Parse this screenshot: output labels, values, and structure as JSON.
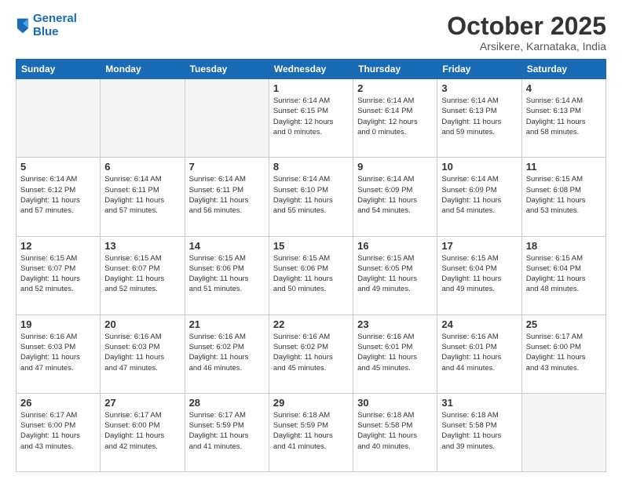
{
  "header": {
    "logo_line1": "General",
    "logo_line2": "Blue",
    "month_title": "October 2025",
    "location": "Arsikere, Karnataka, India"
  },
  "weekdays": [
    "Sunday",
    "Monday",
    "Tuesday",
    "Wednesday",
    "Thursday",
    "Friday",
    "Saturday"
  ],
  "weeks": [
    [
      {
        "day": "",
        "info": ""
      },
      {
        "day": "",
        "info": ""
      },
      {
        "day": "",
        "info": ""
      },
      {
        "day": "1",
        "info": "Sunrise: 6:14 AM\nSunset: 6:15 PM\nDaylight: 12 hours\nand 0 minutes."
      },
      {
        "day": "2",
        "info": "Sunrise: 6:14 AM\nSunset: 6:14 PM\nDaylight: 12 hours\nand 0 minutes."
      },
      {
        "day": "3",
        "info": "Sunrise: 6:14 AM\nSunset: 6:13 PM\nDaylight: 11 hours\nand 59 minutes."
      },
      {
        "day": "4",
        "info": "Sunrise: 6:14 AM\nSunset: 6:13 PM\nDaylight: 11 hours\nand 58 minutes."
      }
    ],
    [
      {
        "day": "5",
        "info": "Sunrise: 6:14 AM\nSunset: 6:12 PM\nDaylight: 11 hours\nand 57 minutes."
      },
      {
        "day": "6",
        "info": "Sunrise: 6:14 AM\nSunset: 6:11 PM\nDaylight: 11 hours\nand 57 minutes."
      },
      {
        "day": "7",
        "info": "Sunrise: 6:14 AM\nSunset: 6:11 PM\nDaylight: 11 hours\nand 56 minutes."
      },
      {
        "day": "8",
        "info": "Sunrise: 6:14 AM\nSunset: 6:10 PM\nDaylight: 11 hours\nand 55 minutes."
      },
      {
        "day": "9",
        "info": "Sunrise: 6:14 AM\nSunset: 6:09 PM\nDaylight: 11 hours\nand 54 minutes."
      },
      {
        "day": "10",
        "info": "Sunrise: 6:14 AM\nSunset: 6:09 PM\nDaylight: 11 hours\nand 54 minutes."
      },
      {
        "day": "11",
        "info": "Sunrise: 6:15 AM\nSunset: 6:08 PM\nDaylight: 11 hours\nand 53 minutes."
      }
    ],
    [
      {
        "day": "12",
        "info": "Sunrise: 6:15 AM\nSunset: 6:07 PM\nDaylight: 11 hours\nand 52 minutes."
      },
      {
        "day": "13",
        "info": "Sunrise: 6:15 AM\nSunset: 6:07 PM\nDaylight: 11 hours\nand 52 minutes."
      },
      {
        "day": "14",
        "info": "Sunrise: 6:15 AM\nSunset: 6:06 PM\nDaylight: 11 hours\nand 51 minutes."
      },
      {
        "day": "15",
        "info": "Sunrise: 6:15 AM\nSunset: 6:06 PM\nDaylight: 11 hours\nand 50 minutes."
      },
      {
        "day": "16",
        "info": "Sunrise: 6:15 AM\nSunset: 6:05 PM\nDaylight: 11 hours\nand 49 minutes."
      },
      {
        "day": "17",
        "info": "Sunrise: 6:15 AM\nSunset: 6:04 PM\nDaylight: 11 hours\nand 49 minutes."
      },
      {
        "day": "18",
        "info": "Sunrise: 6:15 AM\nSunset: 6:04 PM\nDaylight: 11 hours\nand 48 minutes."
      }
    ],
    [
      {
        "day": "19",
        "info": "Sunrise: 6:16 AM\nSunset: 6:03 PM\nDaylight: 11 hours\nand 47 minutes."
      },
      {
        "day": "20",
        "info": "Sunrise: 6:16 AM\nSunset: 6:03 PM\nDaylight: 11 hours\nand 47 minutes."
      },
      {
        "day": "21",
        "info": "Sunrise: 6:16 AM\nSunset: 6:02 PM\nDaylight: 11 hours\nand 46 minutes."
      },
      {
        "day": "22",
        "info": "Sunrise: 6:16 AM\nSunset: 6:02 PM\nDaylight: 11 hours\nand 45 minutes."
      },
      {
        "day": "23",
        "info": "Sunrise: 6:16 AM\nSunset: 6:01 PM\nDaylight: 11 hours\nand 45 minutes."
      },
      {
        "day": "24",
        "info": "Sunrise: 6:16 AM\nSunset: 6:01 PM\nDaylight: 11 hours\nand 44 minutes."
      },
      {
        "day": "25",
        "info": "Sunrise: 6:17 AM\nSunset: 6:00 PM\nDaylight: 11 hours\nand 43 minutes."
      }
    ],
    [
      {
        "day": "26",
        "info": "Sunrise: 6:17 AM\nSunset: 6:00 PM\nDaylight: 11 hours\nand 43 minutes."
      },
      {
        "day": "27",
        "info": "Sunrise: 6:17 AM\nSunset: 6:00 PM\nDaylight: 11 hours\nand 42 minutes."
      },
      {
        "day": "28",
        "info": "Sunrise: 6:17 AM\nSunset: 5:59 PM\nDaylight: 11 hours\nand 41 minutes."
      },
      {
        "day": "29",
        "info": "Sunrise: 6:18 AM\nSunset: 5:59 PM\nDaylight: 11 hours\nand 41 minutes."
      },
      {
        "day": "30",
        "info": "Sunrise: 6:18 AM\nSunset: 5:58 PM\nDaylight: 11 hours\nand 40 minutes."
      },
      {
        "day": "31",
        "info": "Sunrise: 6:18 AM\nSunset: 5:58 PM\nDaylight: 11 hours\nand 39 minutes."
      },
      {
        "day": "",
        "info": ""
      }
    ]
  ]
}
